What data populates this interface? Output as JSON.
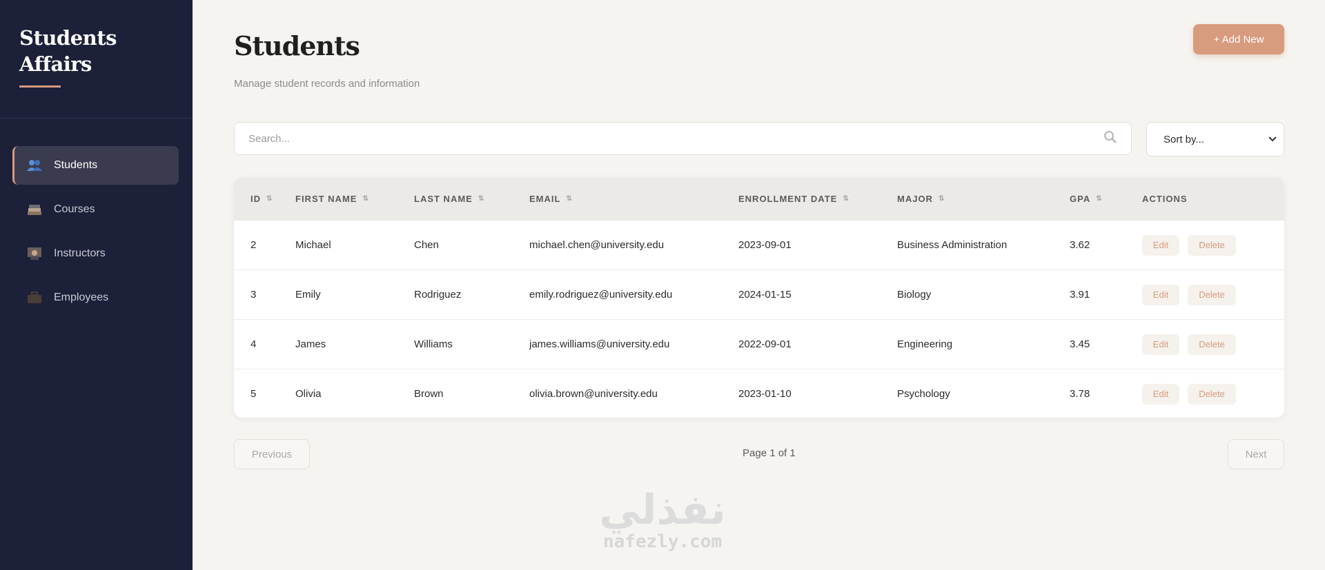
{
  "sidebar": {
    "brand_line1": "Students",
    "brand_line2": "Affairs",
    "items": [
      {
        "label": "Students",
        "icon": "users-icon",
        "active": true
      },
      {
        "label": "Courses",
        "icon": "books-icon",
        "active": false
      },
      {
        "label": "Instructors",
        "icon": "teacher-icon",
        "active": false
      },
      {
        "label": "Employees",
        "icon": "briefcase-icon",
        "active": false
      }
    ]
  },
  "header": {
    "title": "Students",
    "subtitle": "Manage student records and information",
    "add_label": "+ Add New"
  },
  "search": {
    "placeholder": "Search...",
    "value": ""
  },
  "sort": {
    "selected": "Sort by..."
  },
  "table": {
    "columns": [
      "ID",
      "FIRST NAME",
      "LAST NAME",
      "EMAIL",
      "ENROLLMENT DATE",
      "MAJOR",
      "GPA",
      "ACTIONS"
    ],
    "rows": [
      {
        "id": "2",
        "first": "Michael",
        "last": "Chen",
        "email": "michael.chen@university.edu",
        "date": "2023-09-01",
        "major": "Business Administration",
        "gpa": "3.62"
      },
      {
        "id": "3",
        "first": "Emily",
        "last": "Rodriguez",
        "email": "emily.rodriguez@university.edu",
        "date": "2024-01-15",
        "major": "Biology",
        "gpa": "3.91"
      },
      {
        "id": "4",
        "first": "James",
        "last": "Williams",
        "email": "james.williams@university.edu",
        "date": "2022-09-01",
        "major": "Engineering",
        "gpa": "3.45"
      },
      {
        "id": "5",
        "first": "Olivia",
        "last": "Brown",
        "email": "olivia.brown@university.edu",
        "date": "2023-01-10",
        "major": "Psychology",
        "gpa": "3.78"
      }
    ],
    "edit_label": "Edit",
    "delete_label": "Delete"
  },
  "pagination": {
    "prev_label": "Previous",
    "info": "Page 1 of 1",
    "next_label": "Next"
  },
  "watermark": {
    "arabic": "نفذلي",
    "latin": "nafezly.com"
  },
  "colors": {
    "sidebar_bg": "#1c2038",
    "accent": "#d79b7e",
    "page_bg": "#f6f4f1"
  }
}
